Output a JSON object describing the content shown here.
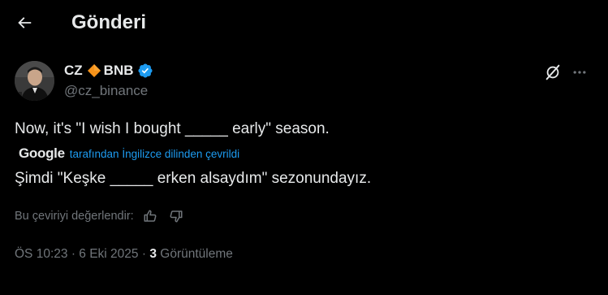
{
  "header": {
    "title": "Gönderi",
    "back_icon": "arrow-left-icon"
  },
  "tweet": {
    "author": {
      "name": "CZ",
      "name_emoji": "orange-diamond-icon",
      "name_suffix": "BNB",
      "handle": "@cz_binance",
      "verified_icon": "verified-badge-icon",
      "verified_color": "#1d9bf0"
    },
    "text": "Now, it's \"I wish I bought _____ early\" season.",
    "translation": {
      "provider": "Google",
      "label": "tarafından İngilizce dilinden çevrildi",
      "text": "Şimdi \"Keşke _____ erken alsaydım\" sezonundayız.",
      "rate_prompt": "Bu çeviriyi değerlendir:"
    },
    "meta": {
      "time": "ÖS 10:23",
      "sep1": "·",
      "date": "6 Eki 2025",
      "sep2": "·",
      "views_count": "3",
      "views_label": "Görüntüleme"
    }
  },
  "colors": {
    "background": "#000000",
    "text_primary": "#e7e9ea",
    "text_secondary": "#71767b",
    "accent": "#1d9bf0",
    "diamond": "#f7931a"
  }
}
